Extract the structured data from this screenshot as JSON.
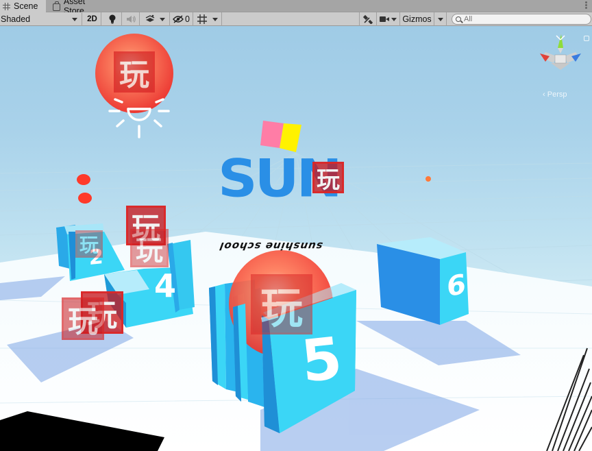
{
  "tabs": {
    "scene": "Scene",
    "asset_store": "Asset Store"
  },
  "toolbar": {
    "shading_mode": "Shaded",
    "mode_2d": "2D",
    "hidden_count": "0",
    "gizmos_label": "Gizmos",
    "search_placeholder": "All"
  },
  "scene": {
    "title_text": "SUN",
    "banner_text": "sunshine school",
    "marker_char": "玩",
    "camera_projection": "Persp",
    "block_numbers": [
      "2",
      "4",
      "5",
      "6"
    ]
  },
  "colors": {
    "sky_top": "#9fcbe6",
    "block_blue": "#39d5f5",
    "title_blue": "#2a8fe6",
    "marker_red": "#c8181e",
    "sphere_red": "#ff5a40"
  },
  "icons": [
    "grid-icon",
    "shopping-bag-icon",
    "lightbulb-icon",
    "audio-icon",
    "effects-icon",
    "visibility-icon",
    "grid-snap-icon",
    "tools-icon",
    "camera-icon",
    "search-icon",
    "sun-light-icon",
    "orientation-gizmo-icon"
  ]
}
